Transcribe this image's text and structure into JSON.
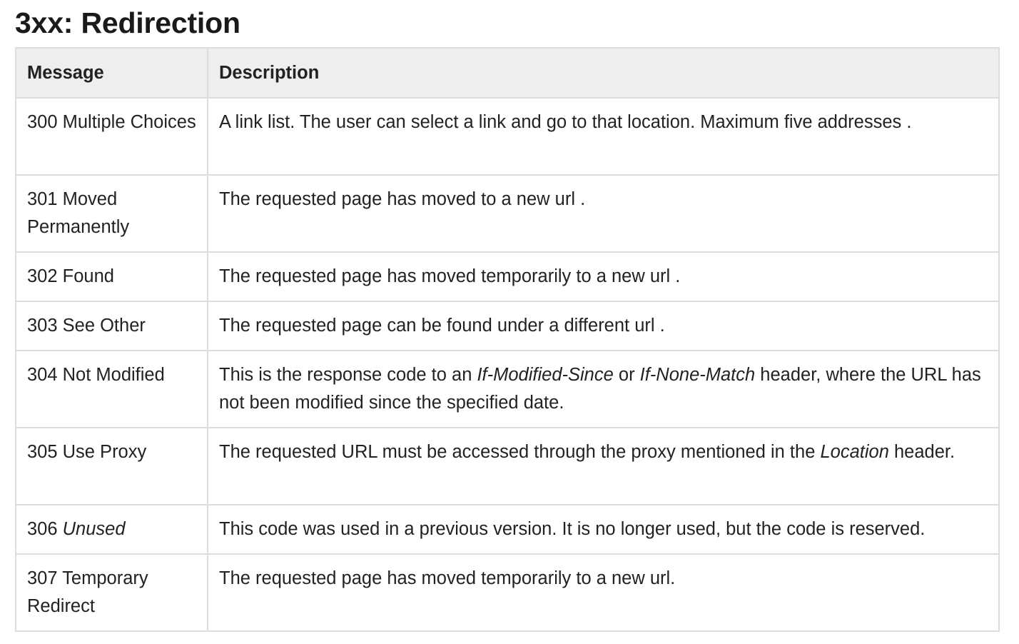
{
  "page": {
    "title": "3xx: Redirection"
  },
  "table": {
    "headers": {
      "message": "Message",
      "description": "Description"
    },
    "rows": [
      {
        "code": "300 Multiple Choices",
        "code_parts": [
          {
            "text": "300 Multiple Choices",
            "italic": false
          }
        ],
        "desc_parts": [
          {
            "text": "A link list. The user can select a link and go to that location. Maximum five addresses  .",
            "italic": false
          }
        ]
      },
      {
        "code": "301 Moved Permanently",
        "code_parts": [
          {
            "text": "301 Moved Permanently",
            "italic": false
          }
        ],
        "desc_parts": [
          {
            "text": "The requested page has moved to a new url .",
            "italic": false
          }
        ]
      },
      {
        "code": "302 Found",
        "code_parts": [
          {
            "text": "302 Found",
            "italic": false
          }
        ],
        "desc_parts": [
          {
            "text": "The requested page has moved temporarily to a new url .",
            "italic": false
          }
        ]
      },
      {
        "code": "303 See Other",
        "code_parts": [
          {
            "text": "303 See Other",
            "italic": false
          }
        ],
        "desc_parts": [
          {
            "text": "The requested page can be found under a different url .",
            "italic": false
          }
        ]
      },
      {
        "code": "304 Not Modified",
        "code_parts": [
          {
            "text": "304 Not Modified",
            "italic": false
          }
        ],
        "desc_parts": [
          {
            "text": "This is the response code to an ",
            "italic": false
          },
          {
            "text": "If-Modified-Since",
            "italic": true
          },
          {
            "text": " or ",
            "italic": false
          },
          {
            "text": "If-None-Match",
            "italic": true
          },
          {
            "text": " header, where the URL has not been modified since the specified date.",
            "italic": false
          }
        ]
      },
      {
        "code": "305 Use Proxy",
        "code_parts": [
          {
            "text": "305 Use Proxy",
            "italic": false
          }
        ],
        "desc_parts": [
          {
            "text": "The requested URL must be accessed through the proxy mentioned in the ",
            "italic": false
          },
          {
            "text": "Location",
            "italic": true
          },
          {
            "text": " header.",
            "italic": false
          }
        ]
      },
      {
        "code": "306 Unused",
        "code_parts": [
          {
            "text": "306 ",
            "italic": false
          },
          {
            "text": "Unused",
            "italic": true
          }
        ],
        "desc_parts": [
          {
            "text": "This code was used in a previous version. It is no longer used, but the code is reserved.",
            "italic": false
          }
        ]
      },
      {
        "code": "307 Temporary Redirect",
        "code_parts": [
          {
            "text": "307 Temporary Redirect",
            "italic": false
          }
        ],
        "desc_parts": [
          {
            "text": "The requested page has moved temporarily to a new url.",
            "italic": false
          }
        ]
      }
    ]
  },
  "colors": {
    "header_bg": "#eeeeee",
    "border": "#dddddd",
    "text": "#222222"
  }
}
